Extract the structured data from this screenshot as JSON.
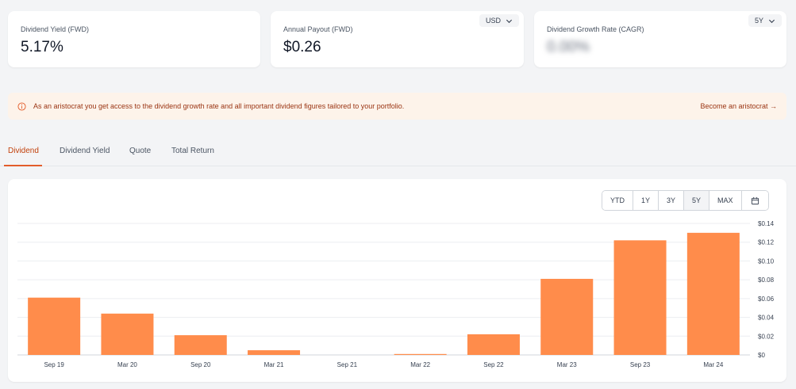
{
  "cards": [
    {
      "label": "Dividend Yield (FWD)",
      "value": "5.17%"
    },
    {
      "label": "Annual Payout (FWD)",
      "value": "$0.26",
      "dropdown": "USD"
    },
    {
      "label": "Dividend Growth Rate (CAGR)",
      "value": "0.00%",
      "dropdown": "5Y"
    }
  ],
  "notice": {
    "text": "As an aristocrat you get access to the dividend growth rate and all important dividend figures tailored to your portfolio.",
    "link": "Become an aristocrat →"
  },
  "tabs": [
    "Dividend",
    "Dividend Yield",
    "Quote",
    "Total Return"
  ],
  "range_buttons": [
    "YTD",
    "1Y",
    "3Y",
    "5Y",
    "MAX"
  ],
  "active_range": "5Y",
  "colors": {
    "bar": "#ff8c4b",
    "accent": "#e35d2b",
    "notice_bg": "#fdf3ea"
  },
  "chart_data": {
    "type": "bar",
    "categories": [
      "Sep 19",
      "Mar 20",
      "Sep 20",
      "Mar 21",
      "Sep 21",
      "Mar 22",
      "Sep 22",
      "Mar 23",
      "Sep 23",
      "Mar 24"
    ],
    "values": [
      0.061,
      0.044,
      0.021,
      0.005,
      0,
      0.001,
      0.022,
      0.081,
      0.122,
      0.13
    ],
    "yticks": [
      "$0",
      "$0.02",
      "$0.04",
      "$0.06",
      "$0.08",
      "$0.10",
      "$0.12",
      "$0.14"
    ],
    "ylim": [
      0,
      0.14
    ],
    "grid": true,
    "y_axis_position": "right"
  }
}
